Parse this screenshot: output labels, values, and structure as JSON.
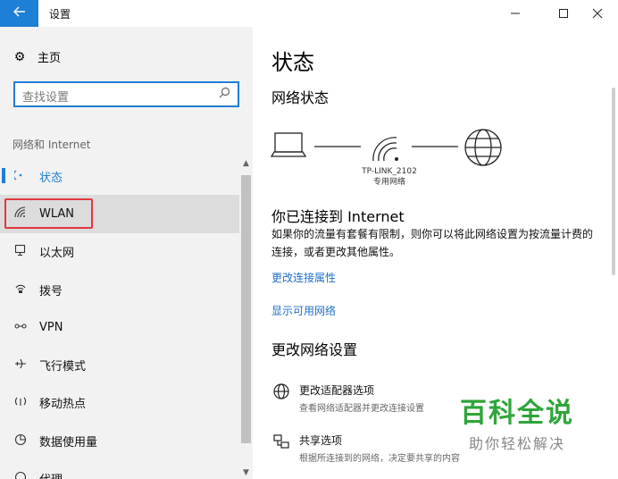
{
  "window": {
    "title": "设置",
    "back_icon": "back-arrow-icon",
    "minimize": "—",
    "maximize": "☐",
    "close": "✕"
  },
  "sidebar": {
    "home_label": "主页",
    "search_placeholder": "查找设置",
    "section_label": "网络和 Internet",
    "items": [
      {
        "label": "状态",
        "icon": "status-icon",
        "active": true
      },
      {
        "label": "WLAN",
        "icon": "wifi-icon",
        "highlighted": true
      },
      {
        "label": "以太网",
        "icon": "ethernet-icon"
      },
      {
        "label": "拨号",
        "icon": "dialup-icon"
      },
      {
        "label": "VPN",
        "icon": "vpn-icon"
      },
      {
        "label": "飞行模式",
        "icon": "airplane-icon"
      },
      {
        "label": "移动热点",
        "icon": "hotspot-icon"
      },
      {
        "label": "数据使用量",
        "icon": "data-usage-icon"
      },
      {
        "label": "代理",
        "icon": "proxy-icon"
      }
    ]
  },
  "main": {
    "page_title": "状态",
    "network_status_title": "网络状态",
    "network_name": "TP-LINK_2102",
    "network_type": "专用网络",
    "connected_title": "你已连接到 Internet",
    "connected_desc": "如果你的流量有套餐有限制，则你可以将此网络设置为按流量计费的连接，或者更改其他属性。",
    "link_properties": "更改连接属性",
    "link_show_networks": "显示可用网络",
    "change_settings_title": "更改网络设置",
    "options": [
      {
        "title": "更改适配器选项",
        "desc": "查看网络适配器并更改连接设置",
        "icon": "adapter-icon"
      },
      {
        "title": "共享选项",
        "desc": "根据所连接到的网络，决定要共享的内容",
        "icon": "sharing-icon"
      }
    ]
  },
  "watermark": {
    "main": "百科全说",
    "sub": "助你轻松解决"
  },
  "colors": {
    "accent": "#1e7fd6",
    "highlight_border": "#e0393e",
    "watermark_green": "#2fa53a"
  }
}
